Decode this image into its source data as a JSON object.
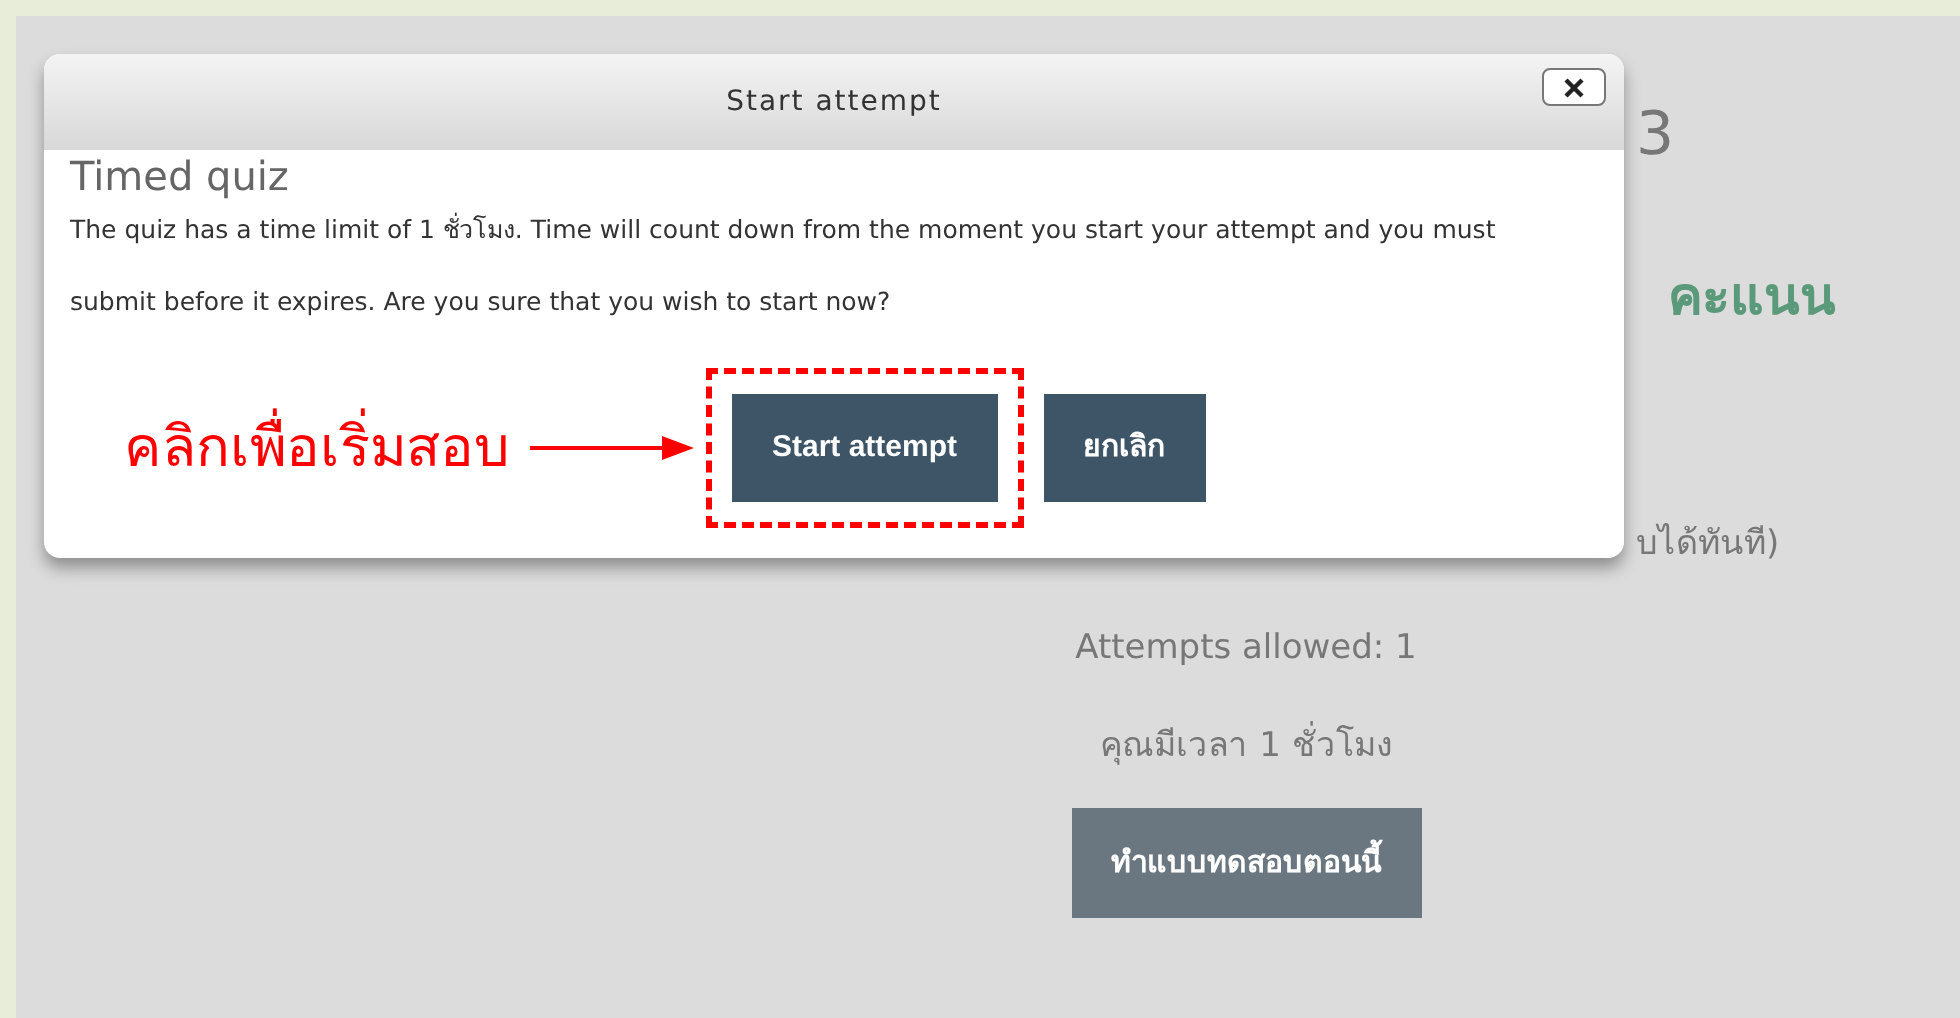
{
  "page": {
    "title_fragment": "3",
    "score_fragment": "คะแนน",
    "note_fragment": "บได้ทันที)",
    "attempts": "Attempts allowed: 1",
    "time_limit": "คุณมีเวลา 1 ชั่วโมง",
    "start_button": "ทำแบบทดสอบตอนนี้"
  },
  "dialog": {
    "title": "Start attempt",
    "heading": "Timed quiz",
    "message": "The quiz has a time limit of 1 ชั่วโมง. Time will count down from the moment you start your attempt and you must submit before it expires. Are you sure that you wish to start now?",
    "buttons": [
      {
        "label": "Start attempt",
        "highlighted": true
      },
      {
        "label": "ยกเลิก",
        "highlighted": false
      }
    ]
  },
  "annotation": {
    "text": "คลิกเพื่อเริ่มสอบ"
  }
}
